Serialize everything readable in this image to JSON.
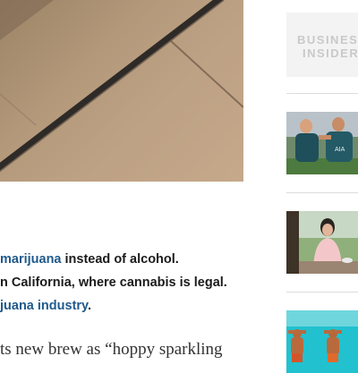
{
  "article": {
    "hero_image": "tile-floor-photo",
    "bullets": [
      {
        "lead": "",
        "link": "marijuana",
        "rest": " instead of alcohol."
      },
      {
        "lead": "n California, where cannabis is legal.",
        "link": "",
        "rest": ""
      },
      {
        "lead": "",
        "link": "juana industry",
        "rest": "."
      }
    ],
    "body_fragment": "ts new brew as “hoppy sparkling"
  },
  "sidebar": {
    "logo_line1": "BUSINESS",
    "logo_line2": "INSIDER",
    "thumbnails": [
      {
        "icon": "soccer-players-photo"
      },
      {
        "icon": "woman-at-table-photo"
      },
      {
        "icon": "beach-people-photo"
      }
    ]
  }
}
